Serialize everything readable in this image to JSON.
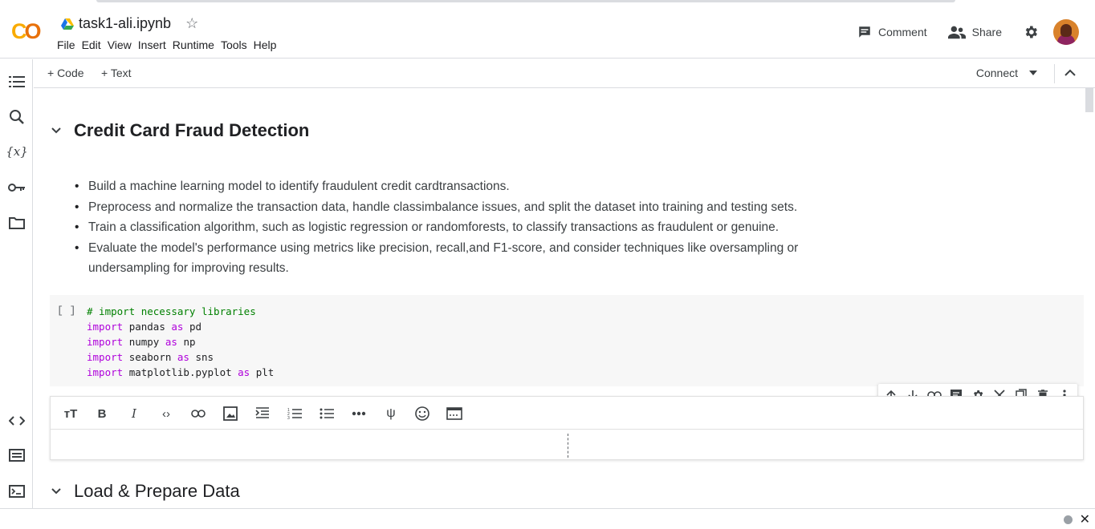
{
  "app": {
    "doc_title": "task1-ali.ipynb",
    "menu": [
      "File",
      "Edit",
      "View",
      "Insert",
      "Runtime",
      "Tools",
      "Help"
    ],
    "comment_label": "Comment",
    "share_label": "Share"
  },
  "toolbar": {
    "code_label": "+ Code",
    "text_label": "+ Text",
    "connect_label": "Connect"
  },
  "section1": {
    "heading": "Credit Card Fraud Detection",
    "bullets": [
      "Build a machine learning model to identify fraudulent credit cardtransactions.",
      "Preprocess and normalize the transaction data, handle classimbalance issues, and split the dataset into training and testing sets.",
      "Train a classification algorithm, such as logistic regression or randomforests, to classify transactions as fraudulent or genuine.",
      "Evaluate the model's performance using metrics like precision, recall,and F1-score, and consider techniques like oversampling or undersampling for improving results."
    ]
  },
  "code_cell": {
    "run_indicator": "[ ]",
    "comment": "# import necessary libraries",
    "lines": [
      {
        "kw": "import",
        "mod": "pandas",
        "as": "as",
        "alias": "pd"
      },
      {
        "kw": "import",
        "mod": "numpy",
        "as": "as",
        "alias": "np"
      },
      {
        "kw": "import",
        "mod": "seaborn",
        "as": "as",
        "alias": "sns"
      },
      {
        "kw": "import",
        "mod": "matplotlib.pyplot",
        "as": "as",
        "alias": "plt"
      }
    ]
  },
  "section2": {
    "heading": "Load & Prepare Data"
  },
  "icons": {
    "sidebar": [
      "toc-icon",
      "search-icon",
      "variables-icon",
      "secrets-key-icon",
      "folder-icon",
      "code-snippets-icon",
      "command-palette-icon",
      "terminal-icon"
    ],
    "format_bar": [
      "text-size-icon",
      "bold-icon",
      "italic-icon",
      "code-icon",
      "link-icon",
      "image-icon",
      "indent-icon",
      "numbered-list-icon",
      "bulleted-list-icon",
      "horizontal-rule-icon",
      "latex-psi-icon",
      "emoji-icon",
      "preview-toggle-icon"
    ],
    "cell_toolbar": [
      "move-up-icon",
      "move-down-icon",
      "copy-link-icon",
      "comment-icon",
      "settings-icon",
      "cut-icon",
      "mirror-cell-icon",
      "delete-icon",
      "more-icon"
    ]
  },
  "colors": {
    "keyword": "#af00db",
    "comment": "#008000",
    "logo_yellow": "#f9ab00",
    "logo_orange": "#e8710a"
  }
}
